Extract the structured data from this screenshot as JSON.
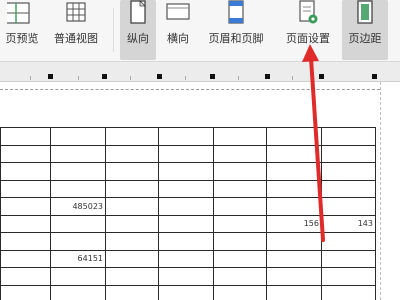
{
  "ribbon": {
    "buttons": [
      {
        "id": "page-preview",
        "label": "页预览",
        "icon": "page-preview-icon"
      },
      {
        "id": "normal-view",
        "label": "普通视图",
        "icon": "grid-view-icon"
      },
      {
        "id": "portrait",
        "label": "纵向",
        "icon": "portrait-icon",
        "active": true
      },
      {
        "id": "landscape",
        "label": "横向",
        "icon": "landscape-icon"
      },
      {
        "id": "header-footer",
        "label": "页眉和页脚",
        "icon": "header-footer-icon"
      },
      {
        "id": "page-setup",
        "label": "页面设置",
        "icon": "page-setup-icon"
      },
      {
        "id": "margins",
        "label": "页边距",
        "icon": "margins-icon",
        "active": true
      }
    ]
  },
  "sheet": {
    "cells": {
      "r4c1": "485023",
      "r5c5": "156",
      "r5c6": "143",
      "r7c1": "64151"
    }
  },
  "colors": {
    "annotation_arrow": "#e02b2b",
    "ribbon_bg": "#f6f6f6",
    "active_button_bg": "#d5d5d5",
    "accent_green": "#3a9a5a",
    "accent_blue": "#3b7bd6"
  }
}
